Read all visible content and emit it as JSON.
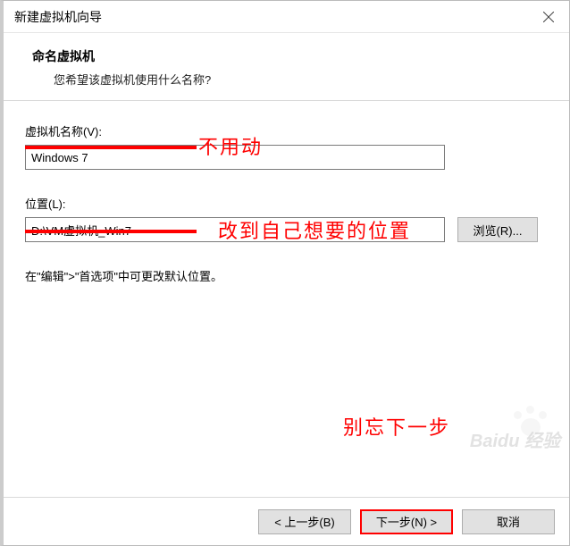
{
  "window": {
    "title": "新建虚拟机向导"
  },
  "header": {
    "subtitle": "命名虚拟机",
    "subdesc": "您希望该虚拟机使用什么名称?"
  },
  "fields": {
    "name_label": "虚拟机名称(V):",
    "name_value": "Windows 7",
    "location_label": "位置(L):",
    "location_value": "D:\\VM虚拟机_Win7",
    "browse_label": "浏览(R)...",
    "hint": "在\"编辑\">\"首选项\"中可更改默认位置。"
  },
  "annotations": {
    "a1": "不用动",
    "a2": "改到自己想要的位置",
    "a3": "别忘下一步"
  },
  "buttons": {
    "back": "< 上一步(B)",
    "next": "下一步(N) >",
    "cancel": "取消"
  },
  "watermark": {
    "brand": "Baidu 经验"
  }
}
